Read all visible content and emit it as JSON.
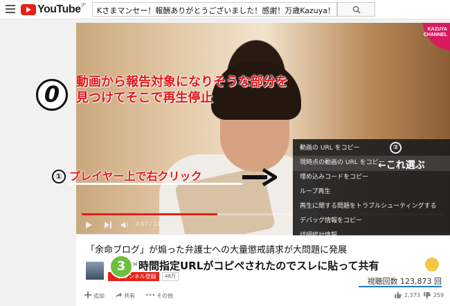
{
  "header": {
    "logo_text": "YouTube",
    "logo_region": "JP",
    "search_value": "Kさまマンセー！報酬ありがとうございました！感謝！万歳Kazuya！"
  },
  "player": {
    "channel_logo": "KAZUYA CHANNEL",
    "time": "4:07 / 11:00",
    "progress": 0.374
  },
  "annotations": {
    "step0_num": "0",
    "step0_text_line1": "動画から報告対象になりそうな部分を",
    "step0_text_line2": "見つけてそこで再生停止",
    "step1_num": "①",
    "step1_text": "プレイヤー上で右クリック",
    "step2_num": "②",
    "step2_text": "←これ選ぶ",
    "step3_num": "3",
    "step3_text": "時間指定URLがコピペされたのでスレに貼って共有"
  },
  "context_menu": {
    "items": [
      "動画の URL をコピー",
      "現時点の動画の URL をコピー",
      "埋め込みコードをコピー",
      "ループ再生",
      "再生に関する問題をトラブルシューティングする",
      "デバッグ情報をコピー",
      "詳細統計情報"
    ]
  },
  "video_info": {
    "title": "「余命ブログ」が煽った弁護士への大量懲戒請求が大問題に発展",
    "channel": "KAZUYA CH",
    "subscribe_label": "チャンネル登録",
    "subscriber_count": "48万",
    "views": "視聴回数 123,873 回",
    "add_label": "追加",
    "share_label": "共有",
    "more_label": "その他",
    "likes": "2,373",
    "dislikes": "259"
  }
}
